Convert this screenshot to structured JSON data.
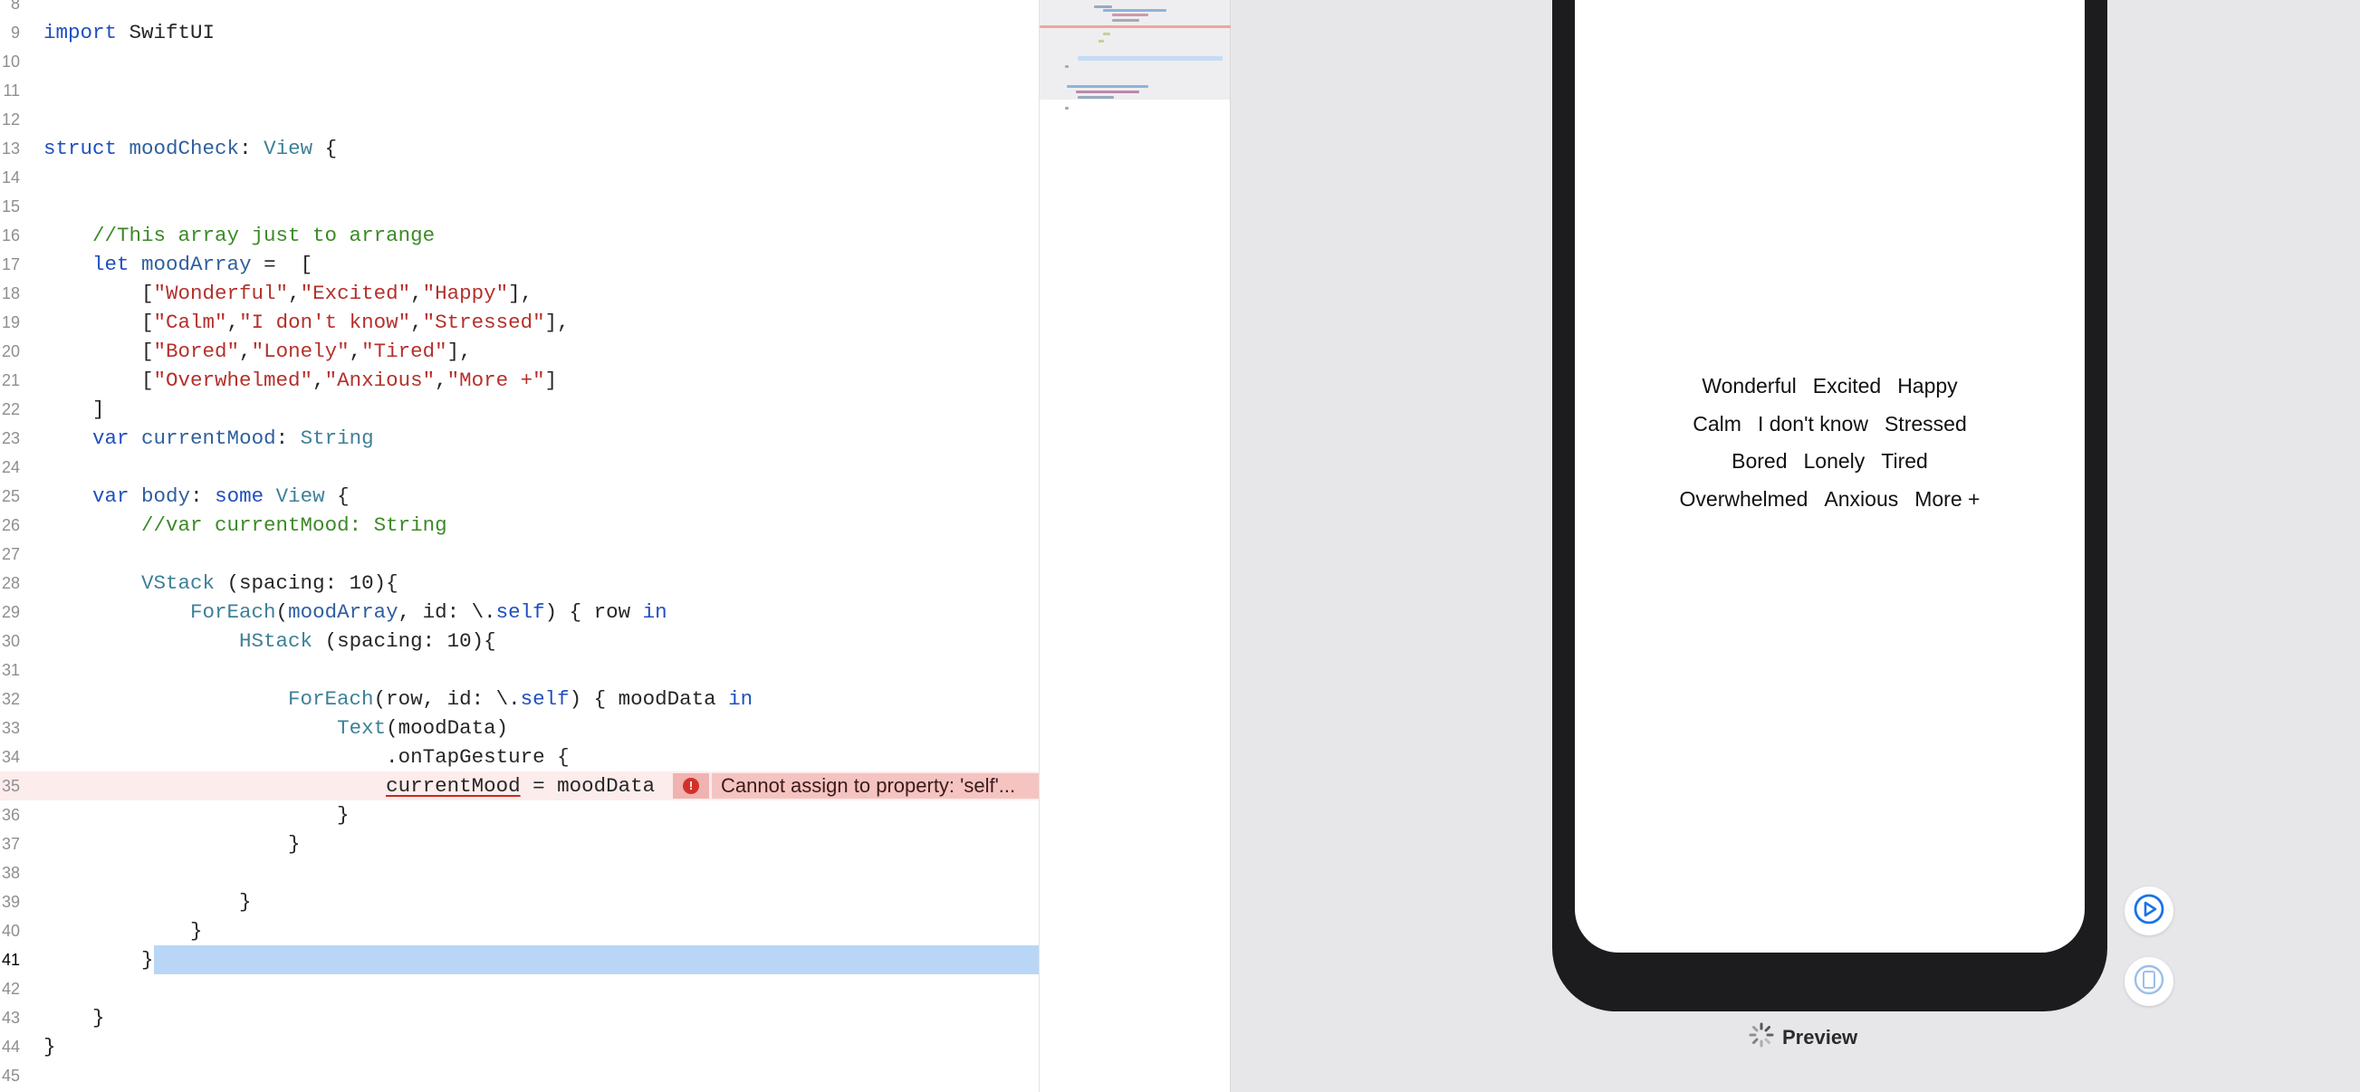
{
  "editor": {
    "lines": [
      {
        "n": "8",
        "text": ""
      },
      {
        "n": "9",
        "text": "import SwiftUI"
      },
      {
        "n": "10",
        "text": ""
      },
      {
        "n": "11",
        "text": ""
      },
      {
        "n": "12",
        "text": ""
      },
      {
        "n": "13",
        "text": "struct moodCheck: View {"
      },
      {
        "n": "14",
        "text": ""
      },
      {
        "n": "15",
        "text": ""
      },
      {
        "n": "16",
        "text": "    //This array just to arrange"
      },
      {
        "n": "17",
        "text": "    let moodArray =  ["
      },
      {
        "n": "18",
        "text": "        [\"Wonderful\",\"Excited\",\"Happy\"],"
      },
      {
        "n": "19",
        "text": "        [\"Calm\",\"I don't know\",\"Stressed\"],"
      },
      {
        "n": "20",
        "text": "        [\"Bored\",\"Lonely\",\"Tired\"],"
      },
      {
        "n": "21",
        "text": "        [\"Overwhelmed\",\"Anxious\",\"More +\"]"
      },
      {
        "n": "22",
        "text": "    ]"
      },
      {
        "n": "23",
        "text": "    var currentMood: String"
      },
      {
        "n": "24",
        "text": ""
      },
      {
        "n": "25",
        "text": "    var body: some View {"
      },
      {
        "n": "26",
        "text": "        //var currentMood: String"
      },
      {
        "n": "27",
        "text": ""
      },
      {
        "n": "28",
        "text": "        VStack (spacing: 10){"
      },
      {
        "n": "29",
        "text": "            ForEach(moodArray, id: \\.self) { row in"
      },
      {
        "n": "30",
        "text": "                HStack (spacing: 10){"
      },
      {
        "n": "31",
        "text": ""
      },
      {
        "n": "32",
        "text": "                    ForEach(row, id: \\.self) { moodData in"
      },
      {
        "n": "33",
        "text": "                        Text(moodData)"
      },
      {
        "n": "34",
        "text": "                            .onTapGesture {"
      },
      {
        "n": "35",
        "text": "                            currentMood = moodData"
      },
      {
        "n": "36",
        "text": "                        }"
      },
      {
        "n": "37",
        "text": "                    }"
      },
      {
        "n": "38",
        "text": ""
      },
      {
        "n": "39",
        "text": "                }"
      },
      {
        "n": "40",
        "text": "            }"
      },
      {
        "n": "41",
        "text": "        }"
      },
      {
        "n": "42",
        "text": ""
      },
      {
        "n": "43",
        "text": "    }"
      },
      {
        "n": "44",
        "text": "}"
      },
      {
        "n": "45",
        "text": ""
      }
    ],
    "active_line": "41",
    "error_line": "35",
    "error_message": "Cannot assign to property: 'self'..."
  },
  "preview": {
    "label": "Preview",
    "mood_rows": [
      [
        "Wonderful",
        "Excited",
        "Happy"
      ],
      [
        "Calm",
        "I don't know",
        "Stressed"
      ],
      [
        "Bored",
        "Lonely",
        "Tired"
      ],
      [
        "Overwhelmed",
        "Anxious",
        "More +"
      ]
    ]
  },
  "colors": {
    "keyword": "#1f4fbf",
    "type": "#3e8097",
    "string": "#b5302b",
    "comment": "#3b8a27",
    "selection": "#bad6f6",
    "error_bg": "#fdecec",
    "accent": "#1a73e8"
  },
  "icons": {
    "error": "error-circle-icon",
    "play": "live-preview-play-icon",
    "device": "device-selector-icon",
    "spinner": "loading-spinner-icon"
  }
}
